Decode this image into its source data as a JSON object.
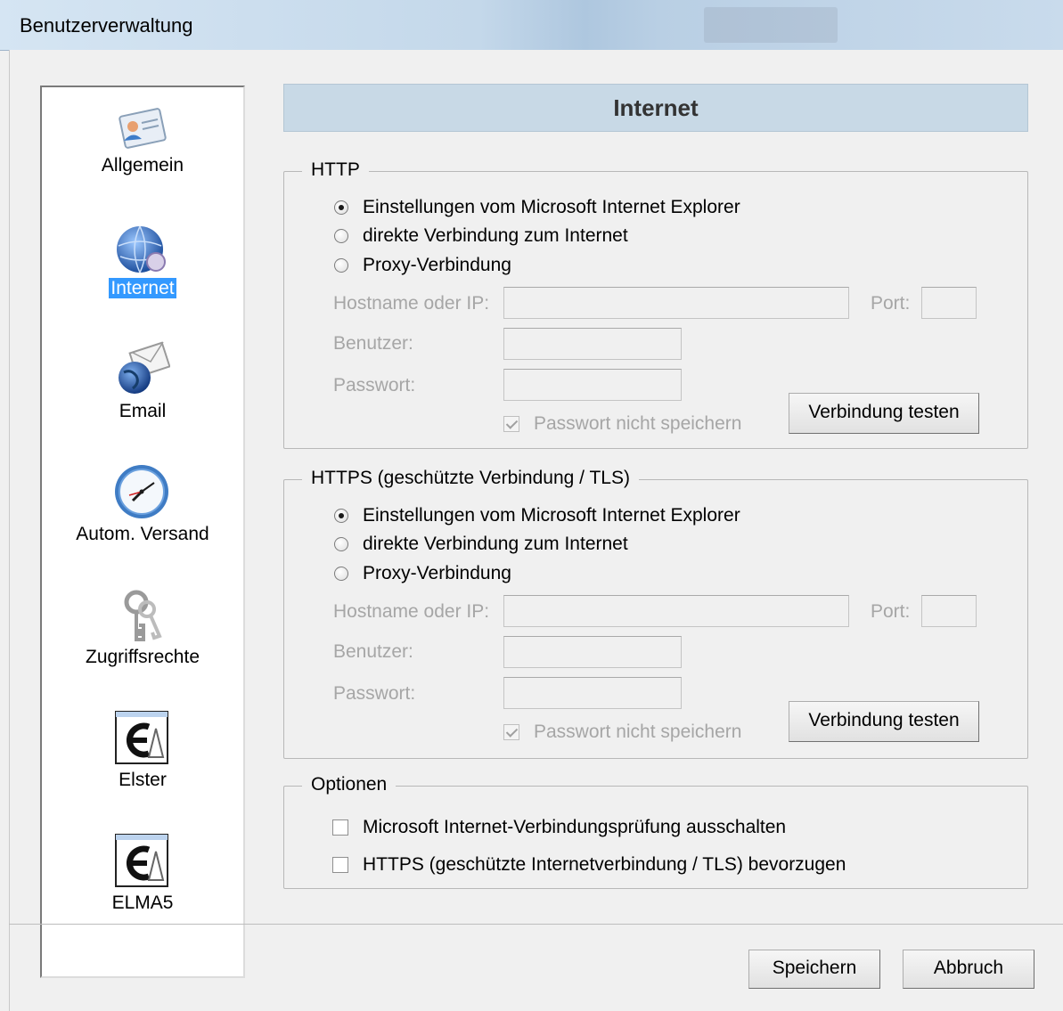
{
  "window": {
    "title": "Benutzerverwaltung"
  },
  "nav": {
    "items": [
      {
        "label": "Allgemein",
        "icon": "user-card-icon",
        "selected": false
      },
      {
        "label": "Internet",
        "icon": "globe-icon",
        "selected": true
      },
      {
        "label": "Email",
        "icon": "email-globe-icon",
        "selected": false
      },
      {
        "label": "Autom. Versand",
        "icon": "clock-icon",
        "selected": false
      },
      {
        "label": "Zugriffsrechte",
        "icon": "keys-icon",
        "selected": false
      },
      {
        "label": "Elster",
        "icon": "elster-icon",
        "selected": false
      },
      {
        "label": "ELMA5",
        "icon": "elma5-icon",
        "selected": false
      }
    ]
  },
  "page": {
    "header": "Internet"
  },
  "http": {
    "title": "HTTP",
    "options": [
      "Einstellungen vom Microsoft Internet Explorer",
      "direkte Verbindung zum Internet",
      "Proxy-Verbindung"
    ],
    "selected_index": 0,
    "host_label": "Hostname oder IP:",
    "host_value": "",
    "port_label": "Port:",
    "port_value": "",
    "user_label": "Benutzer:",
    "user_value": "",
    "password_label": "Passwort:",
    "password_value": "",
    "dont_save_label": "Passwort nicht speichern",
    "dont_save_checked": true,
    "test_button": "Verbindung testen"
  },
  "https": {
    "title": "HTTPS  (geschützte Verbindung / TLS)",
    "options": [
      "Einstellungen vom Microsoft Internet Explorer",
      "direkte Verbindung zum Internet",
      "Proxy-Verbindung"
    ],
    "selected_index": 0,
    "host_label": "Hostname oder IP:",
    "host_value": "",
    "port_label": "Port:",
    "port_value": "",
    "user_label": "Benutzer:",
    "user_value": "",
    "password_label": "Passwort:",
    "password_value": "",
    "dont_save_label": "Passwort nicht speichern",
    "dont_save_checked": true,
    "test_button": "Verbindung testen"
  },
  "options": {
    "title": "Optionen",
    "ms_check_label": "Microsoft Internet-Verbindungsprüfung ausschalten",
    "ms_check_checked": false,
    "prefer_https_label": "HTTPS (geschützte Internetverbindung / TLS) bevorzugen",
    "prefer_https_checked": false
  },
  "footer": {
    "save": "Speichern",
    "cancel": "Abbruch"
  },
  "colors": {
    "header_bg": "#c8d9e6",
    "selection": "#3399ff",
    "disabled_text": "#a6a6a6"
  }
}
